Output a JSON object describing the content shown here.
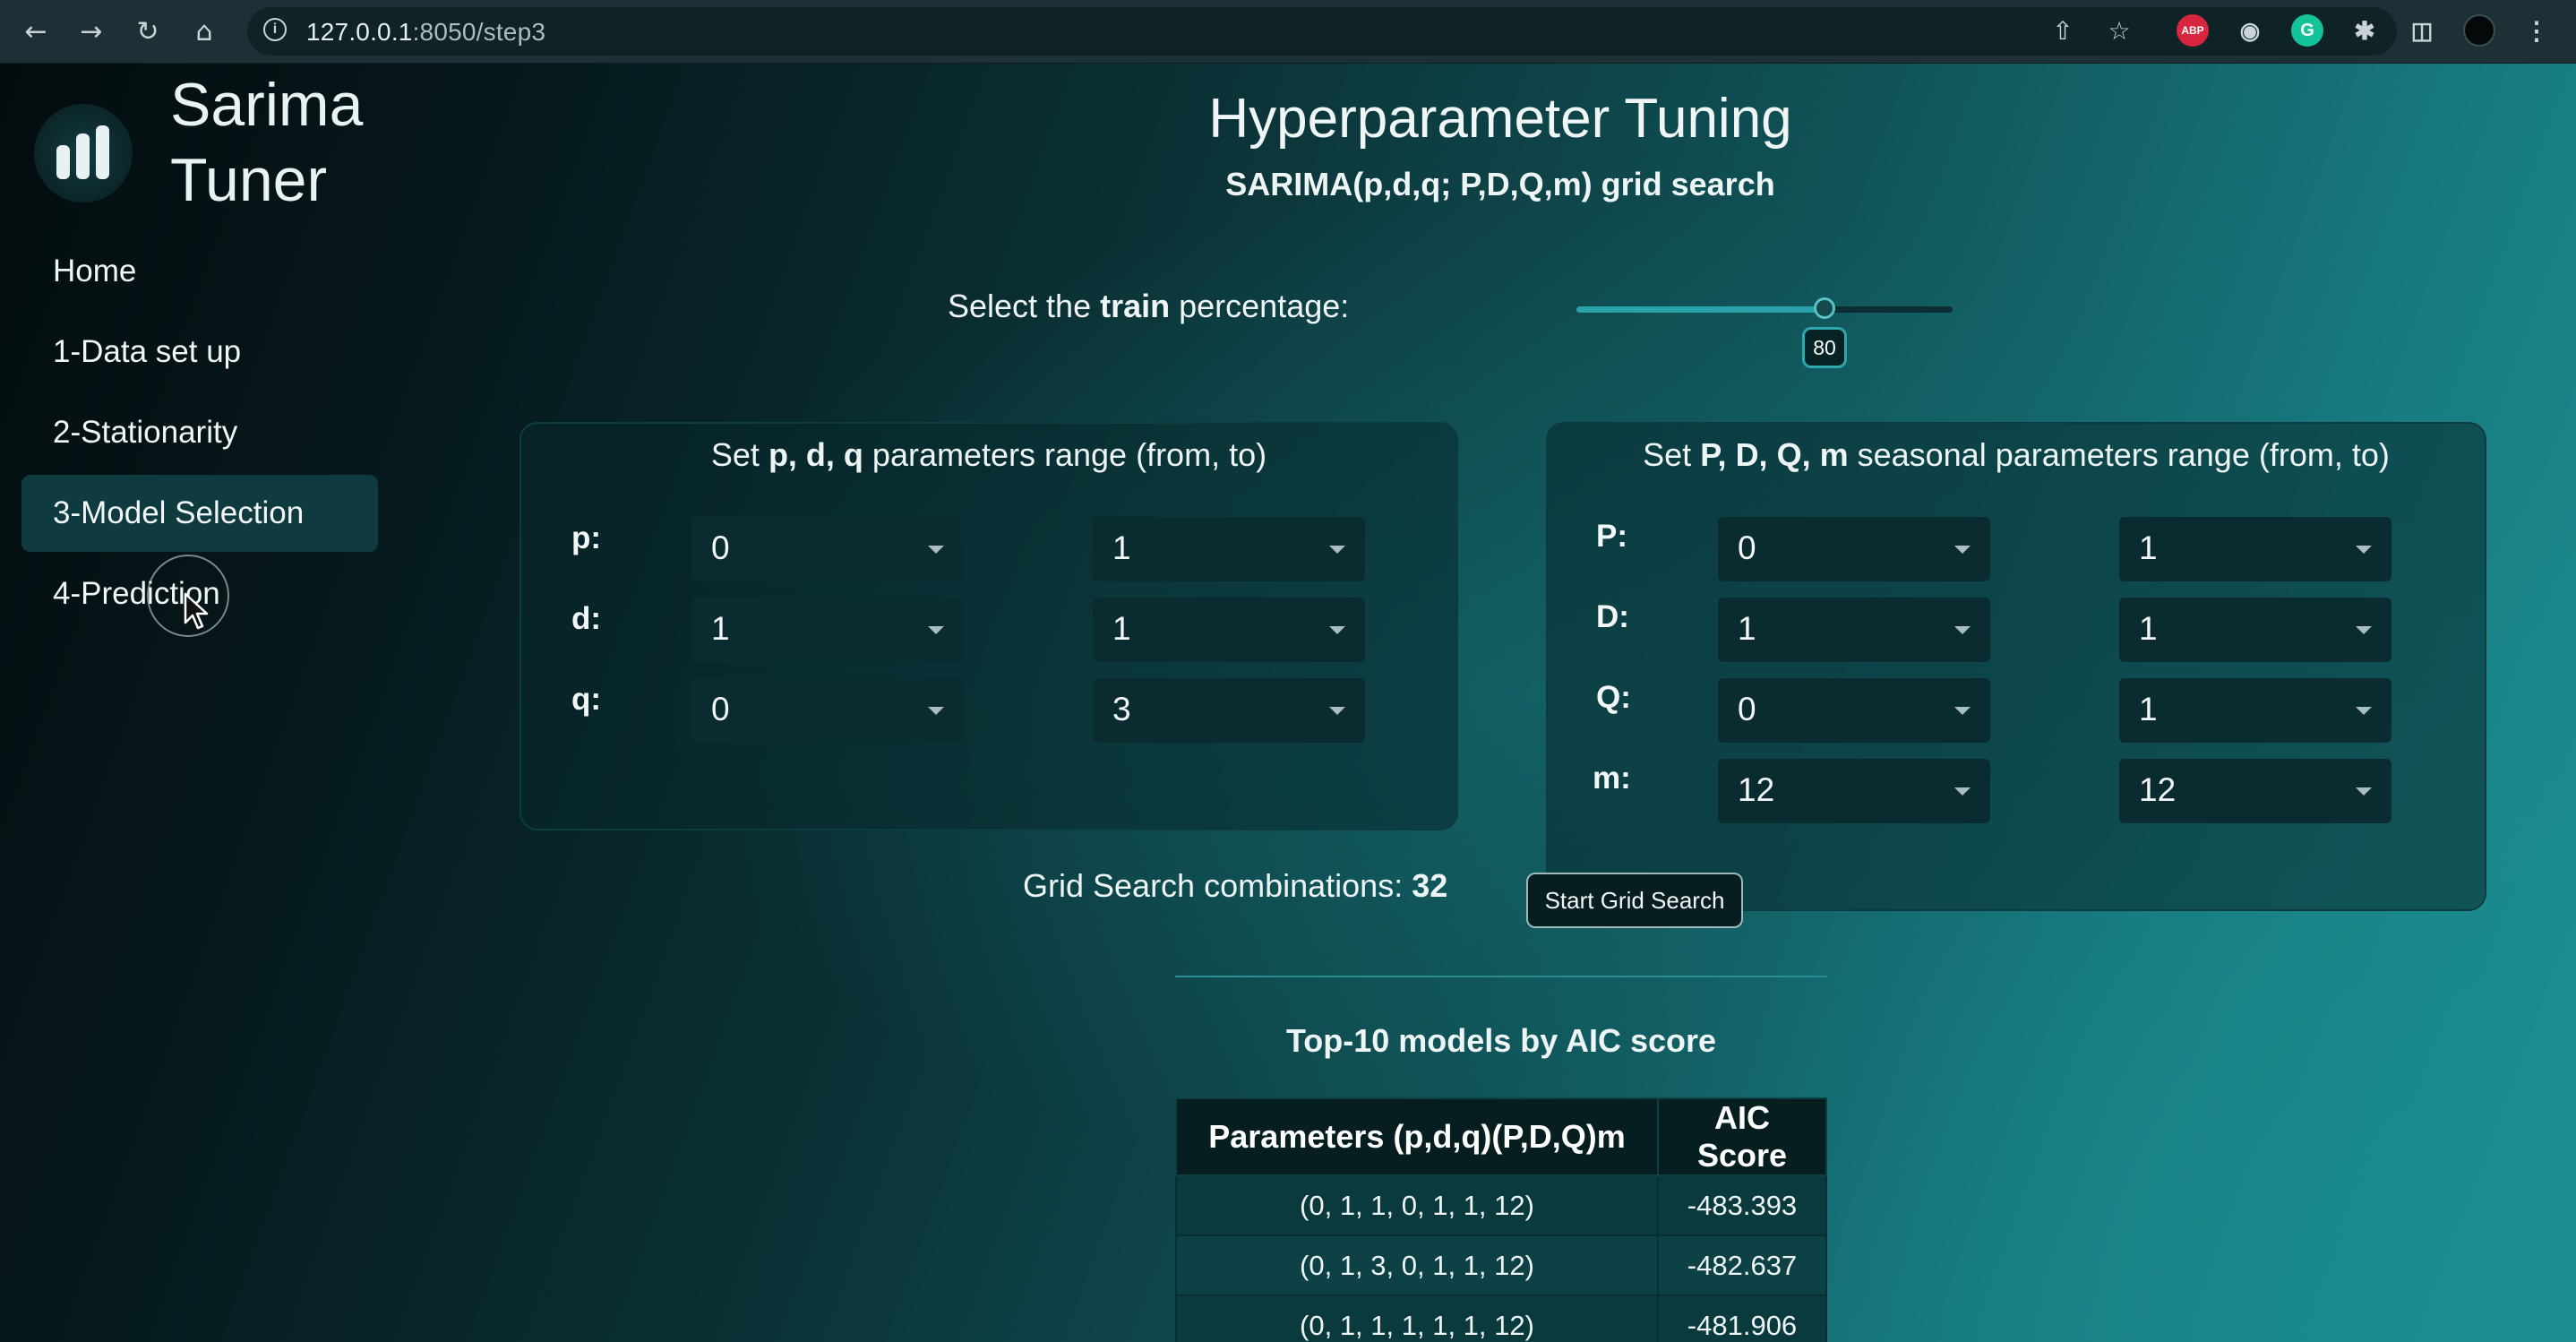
{
  "browser": {
    "url_host": "127.0.0.1",
    "url_path": ":8050/step3",
    "extensions": [
      "ABP",
      "G"
    ]
  },
  "brand": {
    "line1": "Sarima",
    "line2": "Tuner"
  },
  "nav": {
    "items": [
      {
        "label": "Home",
        "active": false
      },
      {
        "label": "1-Data set up",
        "active": false
      },
      {
        "label": "2-Stationarity",
        "active": false
      },
      {
        "label": "3-Model Selection",
        "active": true
      },
      {
        "label": "4-Prediction",
        "active": false
      }
    ]
  },
  "header": {
    "title": "Hyperparameter Tuning",
    "subtitle": "SARIMA(p,d,q; P,D,Q,m) grid search"
  },
  "train": {
    "label_pre": "Select the ",
    "label_bold": "train",
    "label_post": " percentage:",
    "slider_value": "80",
    "slider_fraction": 0.66
  },
  "pdq_panel": {
    "title_pre": "Set ",
    "title_bold": "p, d, q",
    "title_post": " parameters range (from, to)",
    "rows": [
      {
        "label": "p:",
        "from": "0",
        "to": "1"
      },
      {
        "label": "d:",
        "from": "1",
        "to": "1"
      },
      {
        "label": "q:",
        "from": "0",
        "to": "3"
      }
    ]
  },
  "seasonal_panel": {
    "title_pre": "Set ",
    "title_bold": "P, D, Q, m",
    "title_post": " seasonal parameters range (from, to)",
    "rows": [
      {
        "label": "P:",
        "from": "0",
        "to": "1"
      },
      {
        "label": "D:",
        "from": "1",
        "to": "1"
      },
      {
        "label": "Q:",
        "from": "0",
        "to": "1"
      },
      {
        "label": "m:",
        "from": "12",
        "to": "12"
      }
    ]
  },
  "grid": {
    "combinations_label": "Grid Search combinations: ",
    "combinations_value": "32",
    "button_label": "Start Grid Search"
  },
  "results": {
    "title": "Top-10 models by AIC score",
    "headers": [
      "Parameters (p,d,q)(P,D,Q)m",
      "AIC Score"
    ],
    "rows": [
      [
        "(0, 1, 1, 0, 1, 1, 12)",
        "-483.393"
      ],
      [
        "(0, 1, 3, 0, 1, 1, 12)",
        "-482.637"
      ],
      [
        "(0, 1, 1, 1, 1, 1, 12)",
        "-481.906"
      ]
    ]
  },
  "colors": {
    "accent": "#2aa3a8",
    "active_nav": "#0f3a3f",
    "dropdown_bg": "#0a2c30"
  }
}
